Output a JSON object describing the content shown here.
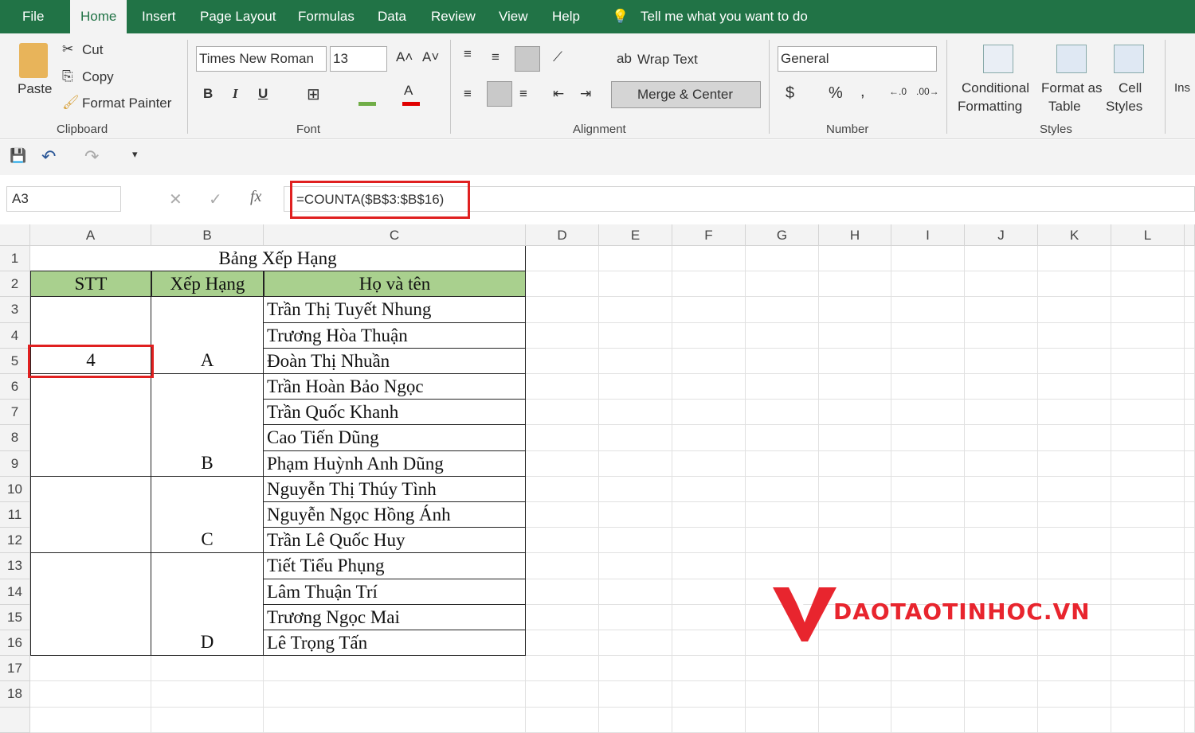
{
  "ribbon_tabs": [
    "File",
    "Home",
    "Insert",
    "Page Layout",
    "Formulas",
    "Data",
    "Review",
    "View",
    "Help"
  ],
  "active_tab": "Home",
  "tell_me": "Tell me what you want to do",
  "clipboard": {
    "paste": "Paste",
    "cut": "Cut",
    "copy": "Copy",
    "format_painter": "Format Painter",
    "group": "Clipboard"
  },
  "font": {
    "name": "Times New Roman",
    "size": "13",
    "bold": "B",
    "italic": "I",
    "underline": "U",
    "group": "Font",
    "font_color": "#e00000",
    "fill_color": "#70ad47"
  },
  "alignment": {
    "wrap_text": "Wrap Text",
    "merge_center": "Merge & Center",
    "group": "Alignment"
  },
  "number": {
    "format": "General",
    "currency": "$",
    "percent": "%",
    "comma": ",",
    "group": "Number"
  },
  "styles": {
    "conditional": [
      "Conditional",
      "Formatting"
    ],
    "format_table": [
      "Format as",
      "Table"
    ],
    "cell_styles": [
      "Cell",
      "Styles"
    ],
    "group": "Styles"
  },
  "insert_cut": "Ins",
  "formula_bar": {
    "name_box": "A3",
    "fx": "fx",
    "formula": "=COUNTA($B$3:$B$16)"
  },
  "columns": [
    "A",
    "B",
    "C",
    "D",
    "E",
    "F",
    "G",
    "H",
    "I",
    "J",
    "K",
    "L"
  ],
  "row_numbers": [
    "1",
    "2",
    "3",
    "4",
    "5",
    "6",
    "7",
    "8",
    "9",
    "10",
    "11",
    "12",
    "13",
    "14",
    "15",
    "16",
    "17",
    "18"
  ],
  "sheet": {
    "title": "Bảng Xếp Hạng",
    "headers": [
      "STT",
      "Xếp Hạng",
      "Họ và tên"
    ],
    "header_color": "#a9d08e",
    "stt_value": "4",
    "ranks": [
      "A",
      "B",
      "C",
      "D"
    ],
    "names": [
      "Trần Thị Tuyết Nhung",
      "Trương Hòa Thuận",
      "Đoàn Thị Nhuần",
      "Trần Hoàn Bảo Ngọc",
      "Trần Quốc Khanh",
      "Cao Tiến Dũng",
      "Phạm Huỳnh Anh Dũng",
      "Nguyễn Thị Thúy Tình",
      "Nguyễn Ngọc Hồng Ánh",
      "Trần Lê Quốc Huy",
      "Tiết Tiểu Phụng",
      "Lâm Thuận Trí",
      "Trương Ngọc Mai",
      "Lê Trọng Tấn"
    ]
  },
  "watermark": "DAOTAOTINHOC.VN",
  "highlight_color": "#e02020"
}
